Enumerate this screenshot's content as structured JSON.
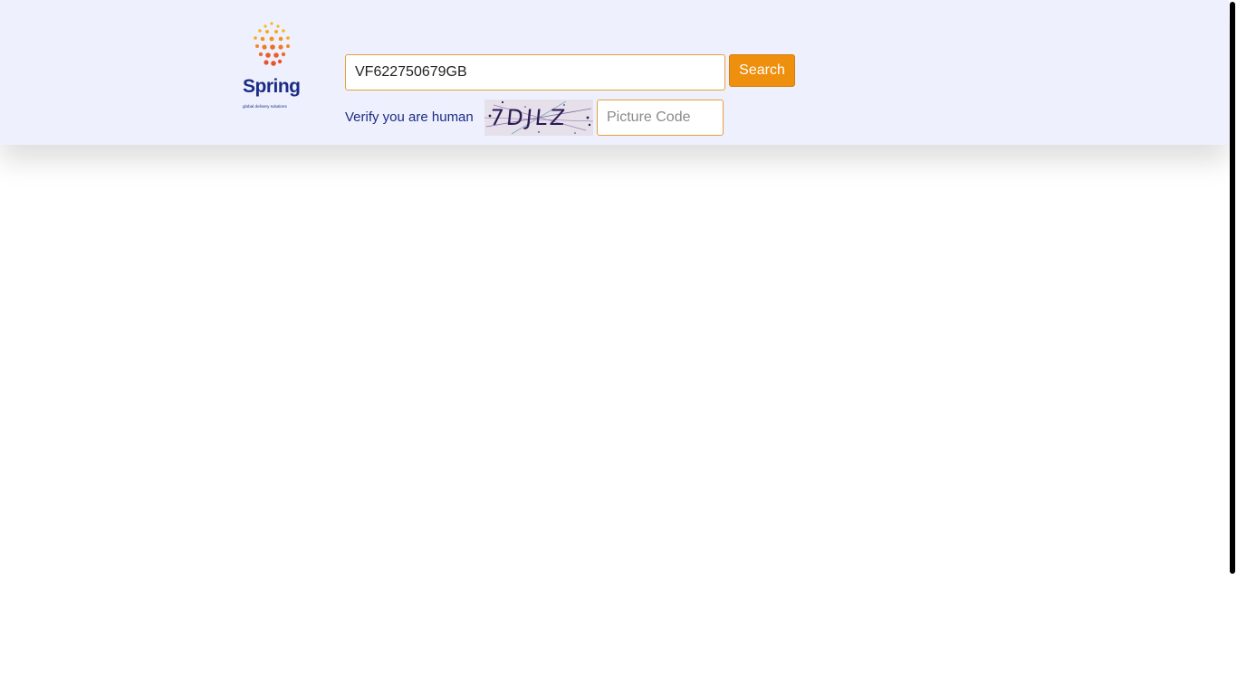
{
  "brand": {
    "name": "Spring",
    "tagline": "global delivery solutions",
    "logo_colors": [
      "#f7b71c",
      "#f39220",
      "#e8532b",
      "#1c2b86"
    ]
  },
  "search": {
    "value": "VF622750679GB",
    "button_label": "Search",
    "button_color": "#ef8f0e"
  },
  "verification": {
    "label": "Verify you are human",
    "captcha_text": "7DJLZ",
    "code_placeholder": "Picture Code"
  },
  "colors": {
    "header_background": "#eef1fd",
    "text_navy": "#1c2b86",
    "input_border": "#e5a03a"
  }
}
